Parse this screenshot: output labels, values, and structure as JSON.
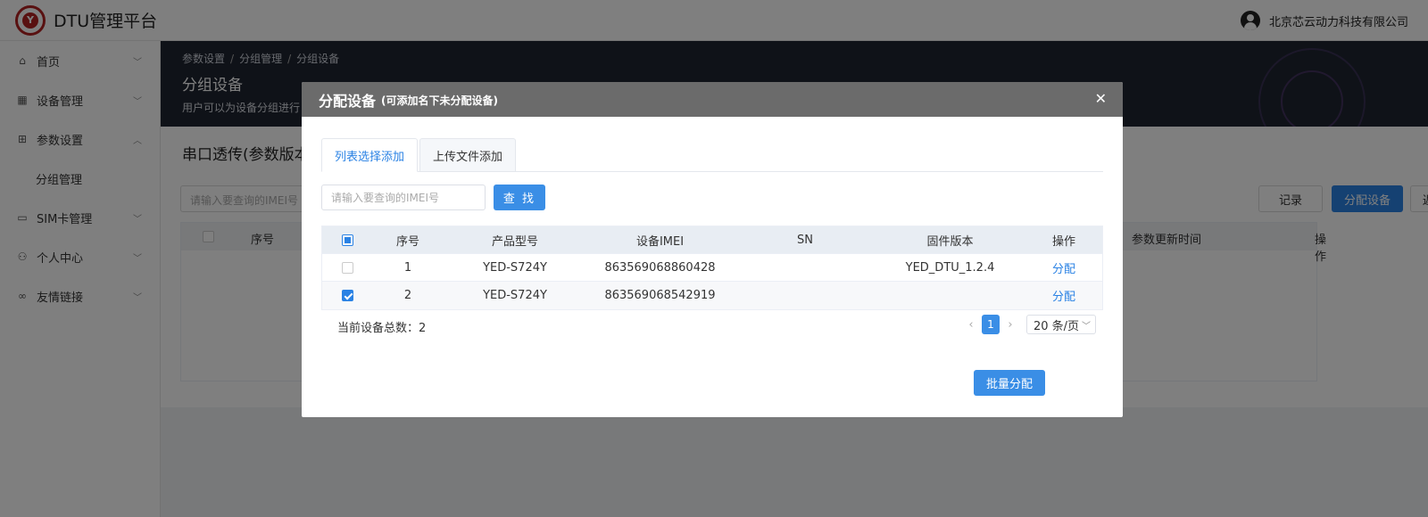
{
  "header": {
    "app_title": "DTU管理平台",
    "logo_text": "Y",
    "company": "北京芯云动力科技有限公司"
  },
  "sidebar": {
    "items": [
      {
        "label": "首页",
        "icon": "home-icon"
      },
      {
        "label": "设备管理",
        "icon": "grid-icon"
      },
      {
        "label": "参数设置",
        "icon": "settings-panel-icon",
        "expanded": true
      },
      {
        "label": "分组管理",
        "sub": true
      },
      {
        "label": "SIM卡管理",
        "icon": "card-icon"
      },
      {
        "label": "个人中心",
        "icon": "user-icon"
      },
      {
        "label": "友情链接",
        "icon": "link-icon"
      }
    ]
  },
  "banner": {
    "breadcrumb": [
      "参数设置",
      "分组管理",
      "分组设备"
    ],
    "title": "分组设备",
    "desc": "用户可以为设备分组进行"
  },
  "content": {
    "section_title": "串口透传(参数版本",
    "search_placeholder": "请输入要查询的IMEI号",
    "records_btn": "记录",
    "assign_btn": "分配设备",
    "back_btn": "返 回",
    "table_headers": [
      "序号",
      "参数更新时间",
      "操作"
    ]
  },
  "modal": {
    "title": "分配设备",
    "subtitle": "(可添加名下未分配设备)",
    "tabs": [
      "列表选择添加",
      "上传文件添加"
    ],
    "search_placeholder": "请输入要查询的IMEI号",
    "search_btn": "查 找",
    "columns": [
      "序号",
      "产品型号",
      "设备IMEI",
      "SN",
      "固件版本",
      "操作"
    ],
    "rows": [
      {
        "index": "1",
        "model": "YED-S724Y",
        "imei": "863569068860428",
        "sn": "",
        "firmware": "YED_DTU_1.2.4",
        "action": "分配",
        "checked": false
      },
      {
        "index": "2",
        "model": "YED-S724Y",
        "imei": "863569068542919",
        "sn": "",
        "firmware": "",
        "action": "分配",
        "checked": true
      }
    ],
    "total_label": "当前设备总数：2",
    "current_page": "1",
    "page_size": "20 条/页",
    "batch_btn": "批量分配"
  },
  "colors": {
    "accent": "#3a8ee6",
    "header_bg": "#6b6b6b",
    "banner_bg": "#1f2430"
  }
}
